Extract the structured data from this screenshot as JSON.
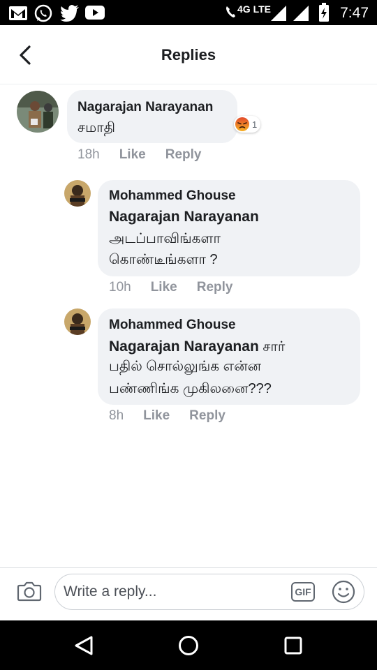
{
  "status_bar": {
    "left_icons": [
      "gmail-icon",
      "whatsapp-icon",
      "twitter-icon",
      "youtube-icon"
    ],
    "network": "4G LTE",
    "time": "7:47"
  },
  "header": {
    "title": "Replies"
  },
  "comments": [
    {
      "author": "Nagarajan Narayanan",
      "text": "சமாதி",
      "reaction": {
        "icon": "angry-reaction-icon",
        "count": "1"
      },
      "time": "18h",
      "like_label": "Like",
      "reply_label": "Reply"
    },
    {
      "author": "Mohammed Ghouse",
      "mention": "Nagarajan Narayanan",
      "text_line1": "அடப்பாவிங்களா",
      "text_line2": "கொண்டீங்களா ?",
      "time": "10h",
      "like_label": "Like",
      "reply_label": "Reply"
    },
    {
      "author": "Mohammed Ghouse",
      "mention": "Nagarajan Narayanan",
      "mention_suffix": " சார்",
      "text_line1": "பதில் சொல்லுங்க என்ன",
      "text_line2": "பண்ணிங்க முகிலனை???",
      "time": "8h",
      "like_label": "Like",
      "reply_label": "Reply"
    }
  ],
  "composer": {
    "placeholder": "Write a reply...",
    "gif_label": "GIF"
  },
  "colors": {
    "bubble": "#f0f2f5",
    "meta_text": "#90949c",
    "reaction_angry": "#e9710f"
  }
}
